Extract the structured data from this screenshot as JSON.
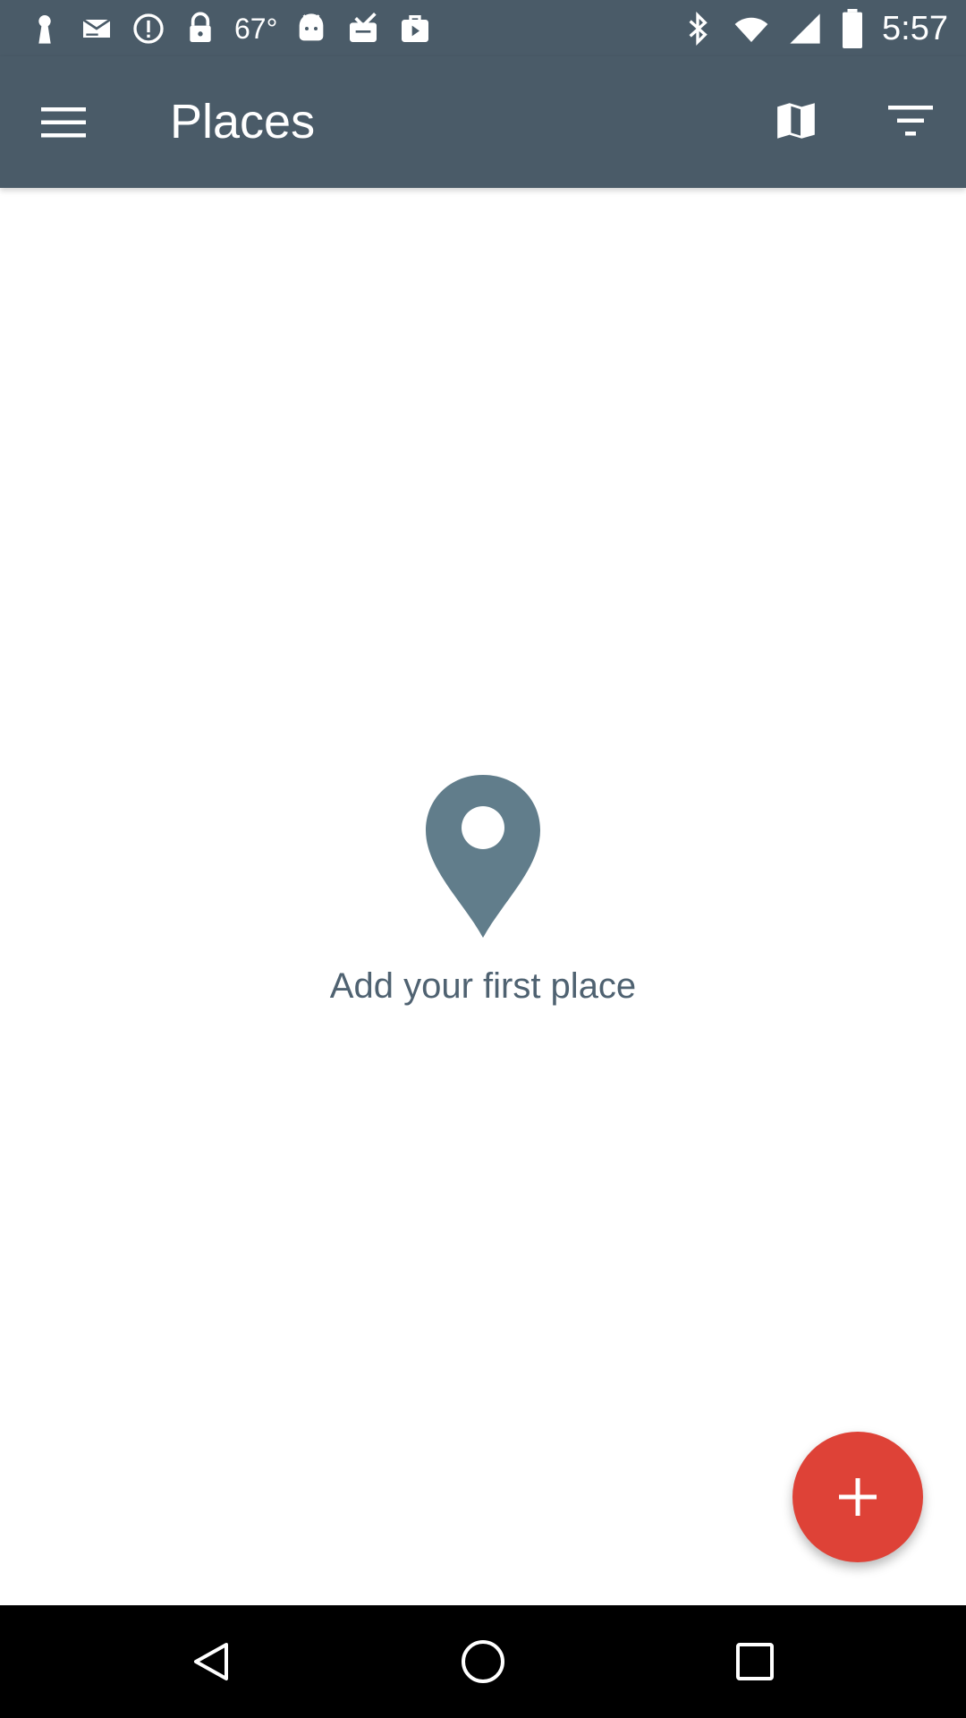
{
  "status_bar": {
    "temperature": "67°",
    "time": "5:57",
    "left_icons": [
      "keyhole-icon",
      "mail-icon",
      "alert-icon",
      "lock-icon",
      "temperature",
      "android-icon",
      "clipboard-check-icon",
      "play-bag-icon"
    ],
    "right_icons": [
      "bluetooth-icon",
      "wifi-icon",
      "signal-icon",
      "battery-icon"
    ]
  },
  "app_bar": {
    "title": "Places",
    "icons": [
      "menu-icon",
      "map-icon",
      "filter-icon"
    ]
  },
  "empty_state": {
    "icon": "location-pin-icon",
    "message": "Add your first place"
  },
  "fab": {
    "icon": "plus-icon"
  },
  "nav_bar": {
    "icons": [
      "back-triangle-icon",
      "home-circle-icon",
      "recents-square-icon"
    ]
  },
  "colors": {
    "app_bar": "#4a5b68",
    "pin": "#617d8b",
    "empty_text": "#4f6271",
    "fab": "#de4237",
    "nav_bar": "#000000"
  }
}
